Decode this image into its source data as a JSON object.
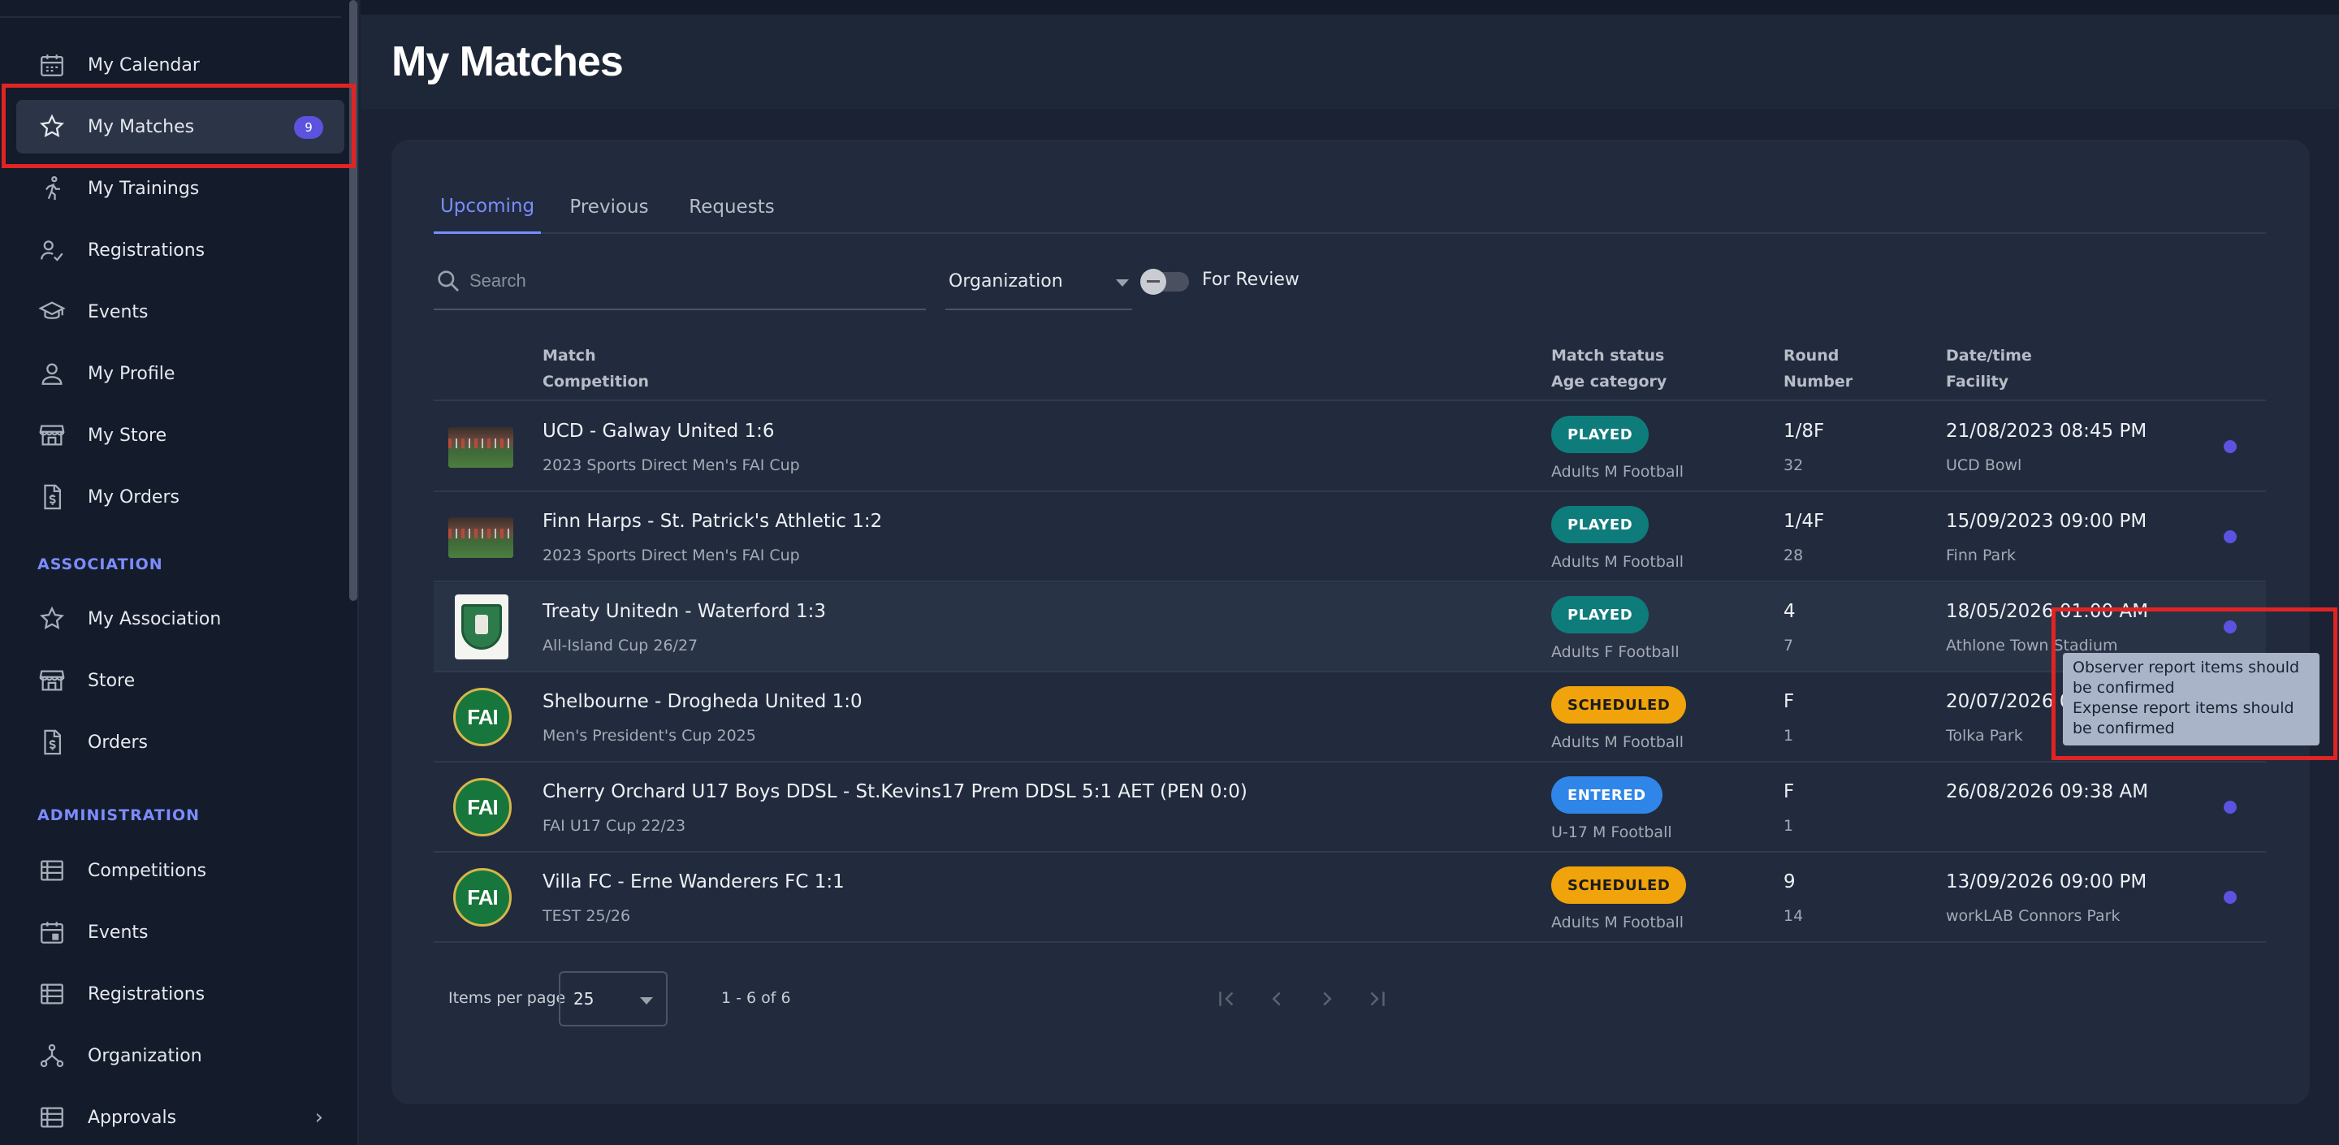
{
  "sidebar": {
    "items_top": [
      {
        "label": "My Calendar",
        "icon": "calendar-icon"
      },
      {
        "label": "My Matches",
        "icon": "star-icon",
        "badge": "9",
        "active": true
      },
      {
        "label": "My Trainings",
        "icon": "running-icon"
      },
      {
        "label": "Registrations",
        "icon": "person-check-icon"
      },
      {
        "label": "Events",
        "icon": "graduation-cap-icon"
      },
      {
        "label": "My Profile",
        "icon": "person-icon"
      },
      {
        "label": "My Store",
        "icon": "store-icon"
      },
      {
        "label": "My Orders",
        "icon": "invoice-icon"
      }
    ],
    "association_title": "ASSOCIATION",
    "association_items": [
      {
        "label": "My Association",
        "icon": "star-icon"
      },
      {
        "label": "Store",
        "icon": "store-icon"
      },
      {
        "label": "Orders",
        "icon": "invoice-icon"
      }
    ],
    "administration_title": "ADMINISTRATION",
    "administration_items": [
      {
        "label": "Competitions",
        "icon": "list-icon"
      },
      {
        "label": "Events",
        "icon": "calendar-event-icon"
      },
      {
        "label": "Registrations",
        "icon": "list-icon"
      },
      {
        "label": "Organization",
        "icon": "hierarchy-icon"
      },
      {
        "label": "Approvals",
        "icon": "list-icon"
      }
    ]
  },
  "page": {
    "title": "My Matches"
  },
  "tabs": [
    "Upcoming",
    "Previous",
    "Requests"
  ],
  "filters": {
    "search_placeholder": "Search",
    "organization": "Organization",
    "toggle_label": "For Review"
  },
  "table": {
    "headers": {
      "match": "Match",
      "competition": "Competition",
      "match_status": "Match status",
      "age_category": "Age category",
      "round": "Round",
      "number": "Number",
      "datetime": "Date/time",
      "facility": "Facility"
    },
    "rows": [
      {
        "match": "UCD - Galway United 1:6",
        "competition": "2023 Sports Direct Men's FAI Cup",
        "status": "PLAYED",
        "age": "Adults M Football",
        "round": "1/8F",
        "number": "32",
        "datetime": "21/08/2023 08:45 PM",
        "facility": "UCD Bowl",
        "image": "pitch-photo"
      },
      {
        "match": "Finn Harps - St. Patrick's Athletic 1:2",
        "competition": "2023 Sports Direct Men's FAI Cup",
        "status": "PLAYED",
        "age": "Adults M Football",
        "round": "1/4F",
        "number": "28",
        "datetime": "15/09/2023 09:00 PM",
        "facility": "Finn Park",
        "image": "pitch-photo"
      },
      {
        "match": "Treaty Unitedn - Waterford 1:3",
        "competition": "All-Island Cup 26/27",
        "status": "PLAYED",
        "age": "Adults F Football",
        "round": "4",
        "number": "7",
        "datetime": "18/05/2026 01:00 AM",
        "facility": "Athlone Town Stadium",
        "image": "club-crest"
      },
      {
        "match": "Shelbourne - Drogheda United 1:0",
        "competition": "Men's President's Cup 2025",
        "status": "SCHEDULED",
        "age": "Adults M Football",
        "round": "F",
        "number": "1",
        "datetime": "20/07/2026 08:45 PM",
        "facility": "Tolka Park",
        "image": "fai-logo"
      },
      {
        "match": "Cherry Orchard U17 Boys DDSL - St.Kevins17 Prem DDSL 5:1 AET (PEN 0:0)",
        "competition": "FAI U17 Cup 22/23",
        "status": "ENTERED",
        "age": "U-17 M Football",
        "round": "F",
        "number": "1",
        "datetime": "26/08/2026 09:38 AM",
        "facility": "",
        "image": "fai-logo"
      },
      {
        "match": "Villa FC - Erne Wanderers FC 1:1",
        "competition": "TEST 25/26",
        "status": "SCHEDULED",
        "age": "Adults M Football",
        "round": "9",
        "number": "14",
        "datetime": "13/09/2026 09:00 PM",
        "facility": "workLAB Connors Park",
        "image": "fai-logo"
      }
    ]
  },
  "tooltip": {
    "line1": "Observer report items should be confirmed",
    "line2": "Expense report items should be confirmed"
  },
  "pagination": {
    "items_per_page_label": "Items per page",
    "items_per_page": "25",
    "range": "1 - 6 of 6"
  },
  "fai_logo_text": "FAI",
  "colors": {
    "accent": "#7b8cff",
    "badge": "#5b53e0",
    "played": "#0e7c7b",
    "scheduled": "#f0a30a",
    "entered": "#2f86e8",
    "annotation": "#e02424"
  }
}
